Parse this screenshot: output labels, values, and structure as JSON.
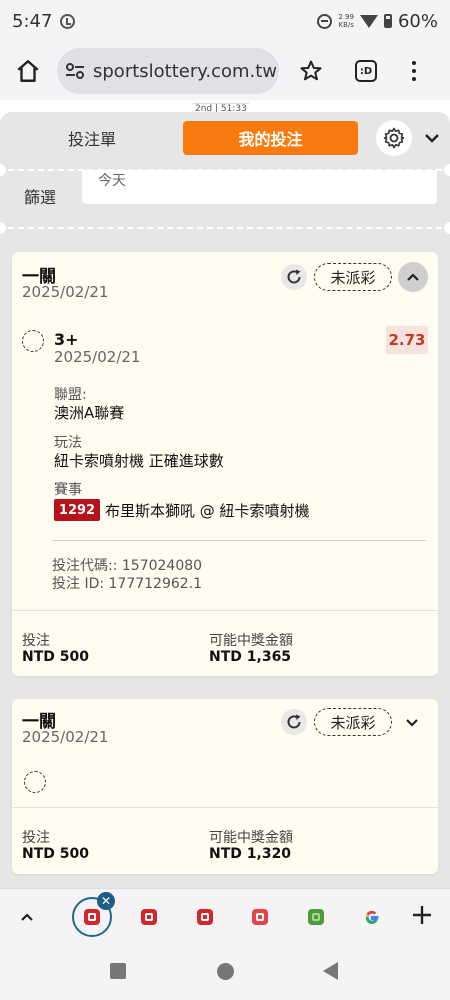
{
  "status_bar": {
    "time": "5:47",
    "net_speed_value": "2.99",
    "net_speed_unit": "KB/s",
    "battery": "60%"
  },
  "browser": {
    "url": "sportslottery.com.tw",
    "tab_icon": ":D"
  },
  "page_top": {
    "match_timer": "2nd | 51:33"
  },
  "tabs": {
    "bet_slip": "投注單",
    "my_bets": "我的投注",
    "active": "my_bets"
  },
  "filter": {
    "label": "篩選",
    "value": "今天"
  },
  "bets": [
    {
      "title": "一關",
      "date": "2025/02/21",
      "status": "未派彩",
      "expanded": true,
      "selection": {
        "name": "3+",
        "date": "2025/02/21",
        "odds": "2.73",
        "league_label": "聯盟:",
        "league": "澳洲A聯賽",
        "market_label": "玩法",
        "market": "紐卡索噴射機 正確進球數",
        "event_label": "賽事",
        "event_no": "1292",
        "event": "布里斯本獅吼 @ 紐卡索噴射機"
      },
      "bet_code": "投注代碼:: 157024080",
      "bet_id": "投注 ID: 177712962.1",
      "stake_label": "投注",
      "stake": "NTD 500",
      "payout_label": "可能中獎金額",
      "payout": "NTD 1,365"
    },
    {
      "title": "一關",
      "date": "2025/02/21",
      "status": "未派彩",
      "expanded": false,
      "stake_label": "投注",
      "stake": "NTD 500",
      "payout_label": "可能中獎金額",
      "payout": "NTD 1,320"
    }
  ],
  "colors": {
    "accent_orange": "#fb7a10",
    "match_no_red": "#b5121b",
    "odds_text": "#c0392b",
    "card_bg": "#fffcf0"
  },
  "icons": [
    "home-icon",
    "site-settings-icon",
    "star-icon",
    "menu-icon",
    "gear-icon",
    "chevron-down-icon",
    "refresh-icon",
    "chevron-up-icon",
    "close-icon",
    "plus-icon",
    "google-icon"
  ]
}
